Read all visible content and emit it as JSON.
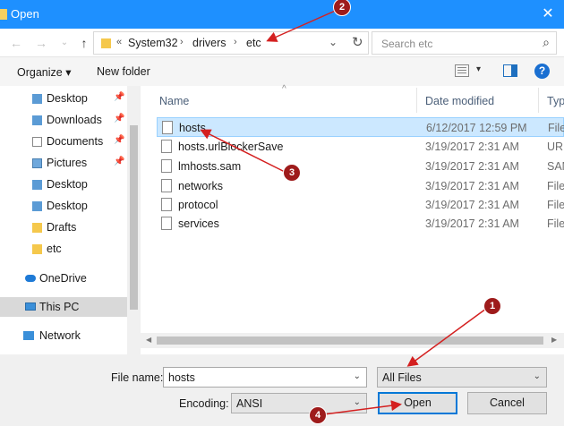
{
  "window": {
    "title": "Open",
    "close_glyph": "✕"
  },
  "address": {
    "back_glyph": "←",
    "forward_glyph": "→",
    "recent_glyph": "⌄",
    "up_glyph": "↑",
    "overflow": "«",
    "parts": [
      "System32",
      "drivers",
      "etc"
    ],
    "separator": "›",
    "dropdown_glyph": "⌄",
    "refresh_glyph": "↻"
  },
  "search": {
    "placeholder": "Search etc",
    "icon_glyph": "⌕"
  },
  "toolbar": {
    "organize_label": "Organize ▾",
    "new_folder_label": "New folder",
    "view_chev": "▾",
    "help_glyph": "?"
  },
  "nav": {
    "pin_glyph": "📌",
    "items": [
      {
        "label": "Desktop",
        "pinned": true
      },
      {
        "label": "Downloads",
        "pinned": true
      },
      {
        "label": "Documents",
        "pinned": true
      },
      {
        "label": "Pictures",
        "pinned": true
      },
      {
        "label": "Desktop",
        "pinned": false
      },
      {
        "label": "Desktop",
        "pinned": false
      },
      {
        "label": "Drafts",
        "pinned": false
      },
      {
        "label": "etc",
        "pinned": false
      }
    ],
    "onedrive": "OneDrive",
    "thispc": "This PC",
    "network": "Network"
  },
  "columns": {
    "name": "Name",
    "date": "Date modified",
    "type": "Typ"
  },
  "files": [
    {
      "name": "hosts",
      "date": "6/12/2017 12:59 PM",
      "type": "File"
    },
    {
      "name": "hosts.urlBlockerSave",
      "date": "3/19/2017 2:31 AM",
      "type": "URL"
    },
    {
      "name": "lmhosts.sam",
      "date": "3/19/2017 2:31 AM",
      "type": "SAM"
    },
    {
      "name": "networks",
      "date": "3/19/2017 2:31 AM",
      "type": "File"
    },
    {
      "name": "protocol",
      "date": "3/19/2017 2:31 AM",
      "type": "File"
    },
    {
      "name": "services",
      "date": "3/19/2017 2:31 AM",
      "type": "File"
    }
  ],
  "scroll": {
    "left_glyph": "◀",
    "right_glyph": "▶"
  },
  "bottom": {
    "filename_label": "File name:",
    "filename_value": "hosts",
    "filetype_value": "All Files",
    "encoding_label": "Encoding:",
    "encoding_value": "ANSI",
    "open_label": "Open",
    "cancel_label": "Cancel",
    "chev": "⌄"
  },
  "annotations": [
    "1",
    "2",
    "3",
    "4"
  ],
  "colors": {
    "titlebar": "#1e90ff",
    "selection": "#cce8ff",
    "annotation": "#9e1b1b"
  }
}
